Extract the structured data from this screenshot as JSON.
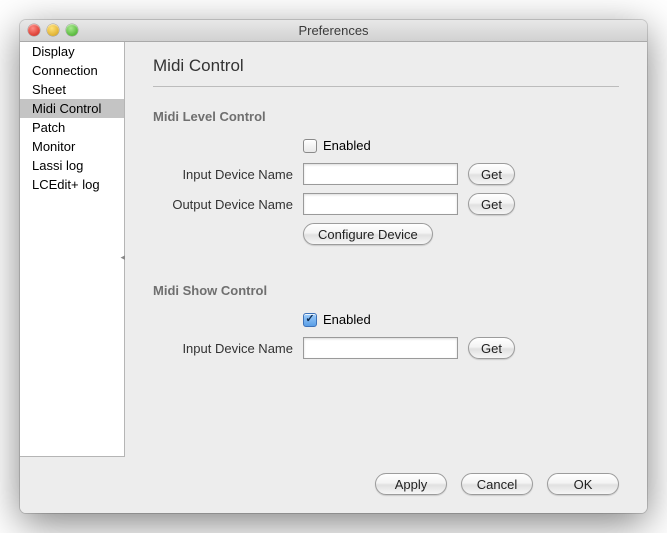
{
  "window": {
    "title": "Preferences"
  },
  "sidebar": {
    "items": [
      {
        "label": "Display",
        "selected": false
      },
      {
        "label": "Connection",
        "selected": false
      },
      {
        "label": "Sheet",
        "selected": false
      },
      {
        "label": "Midi Control",
        "selected": true
      },
      {
        "label": "Patch",
        "selected": false
      },
      {
        "label": "Monitor",
        "selected": false
      },
      {
        "label": "Lassi log",
        "selected": false
      },
      {
        "label": "LCEdit+ log",
        "selected": false
      }
    ]
  },
  "page": {
    "title": "Midi Control",
    "level": {
      "section_label": "Midi Level Control",
      "enabled_label": "Enabled",
      "enabled": false,
      "input_label": "Input Device Name",
      "input_value": "",
      "output_label": "Output Device Name",
      "output_value": "",
      "get_label": "Get",
      "configure_label": "Configure Device"
    },
    "show": {
      "section_label": "Midi Show Control",
      "enabled_label": "Enabled",
      "enabled": true,
      "input_label": "Input Device Name",
      "input_value": "",
      "get_label": "Get"
    }
  },
  "footer": {
    "apply": "Apply",
    "cancel": "Cancel",
    "ok": "OK"
  }
}
